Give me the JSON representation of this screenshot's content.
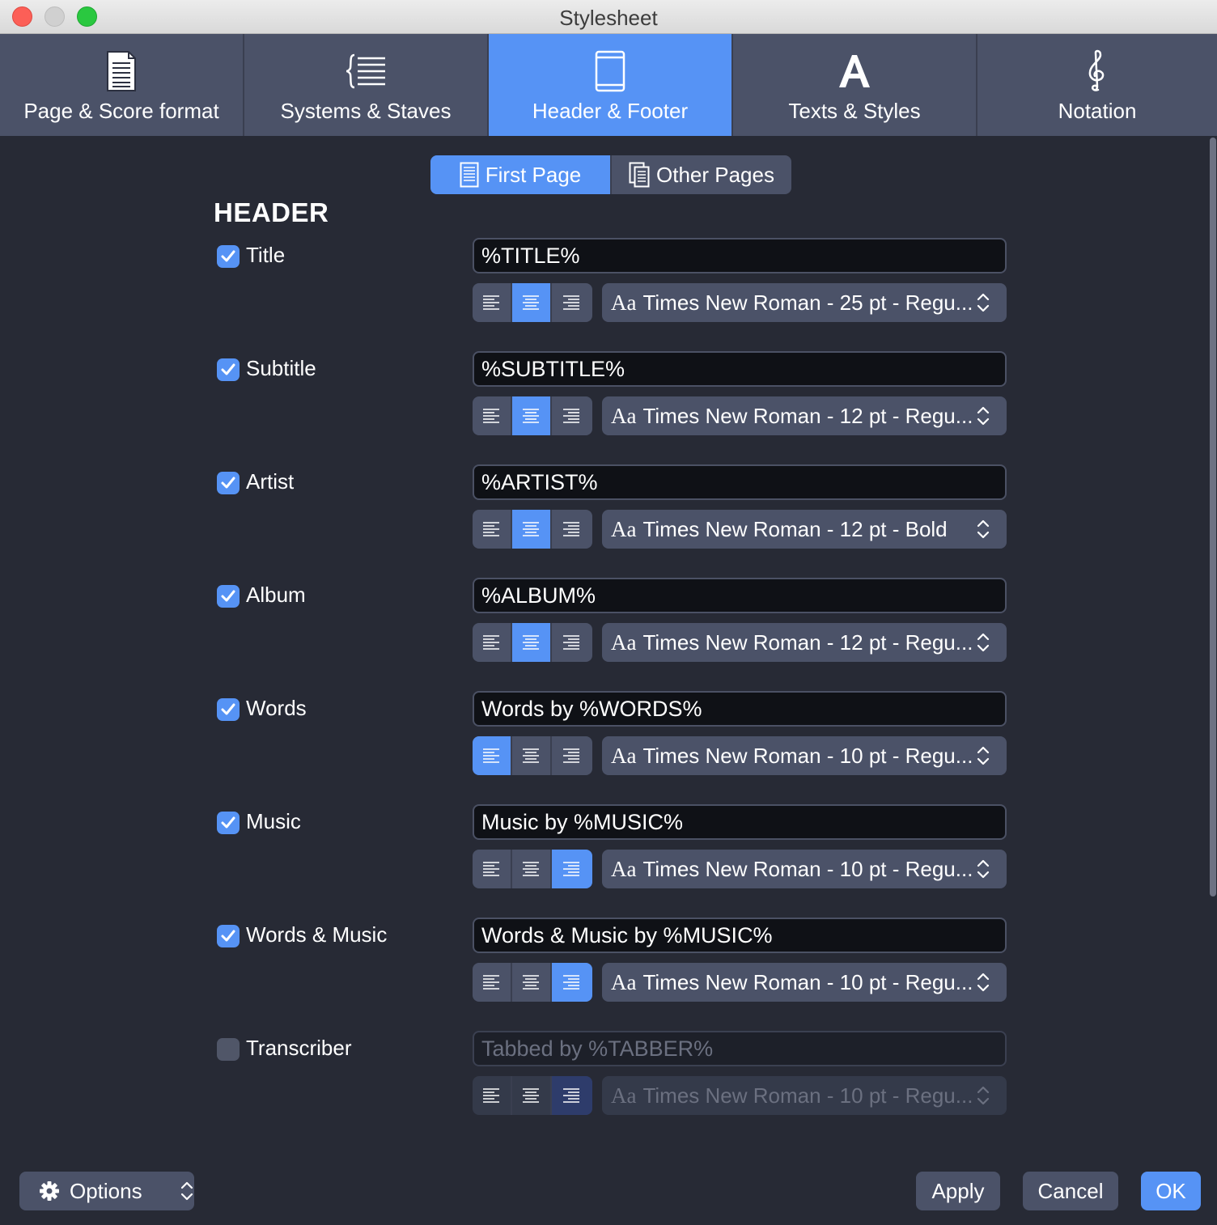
{
  "window": {
    "title": "Stylesheet"
  },
  "tabs": [
    {
      "label": "Page & Score format",
      "icon": "page-icon",
      "active": false
    },
    {
      "label": "Systems & Staves",
      "icon": "staves-icon",
      "active": false
    },
    {
      "label": "Header & Footer",
      "icon": "header-footer-icon",
      "active": true
    },
    {
      "label": "Texts & Styles",
      "icon": "letter-a-icon",
      "active": false
    },
    {
      "label": "Notation",
      "icon": "treble-clef-icon",
      "active": false
    }
  ],
  "page_selector": {
    "first_page": "First Page",
    "other_pages": "Other Pages",
    "selected": "First Page"
  },
  "section_title": "HEADER",
  "fields": [
    {
      "label": "Title",
      "checked": true,
      "value": "%TITLE%",
      "align": "center",
      "font": "Times New Roman - 25 pt - Regu..."
    },
    {
      "label": "Subtitle",
      "checked": true,
      "value": "%SUBTITLE%",
      "align": "center",
      "font": "Times New Roman - 12 pt - Regu..."
    },
    {
      "label": "Artist",
      "checked": true,
      "value": "%ARTIST%",
      "align": "center",
      "font": "Times New Roman - 12 pt - Bold"
    },
    {
      "label": "Album",
      "checked": true,
      "value": "%ALBUM%",
      "align": "center",
      "font": "Times New Roman - 12 pt - Regu..."
    },
    {
      "label": "Words",
      "checked": true,
      "value": "Words by %WORDS%",
      "align": "left",
      "font": "Times New Roman - 10 pt - Regu..."
    },
    {
      "label": "Music",
      "checked": true,
      "value": "Music by %MUSIC%",
      "align": "right",
      "font": "Times New Roman - 10 pt - Regu..."
    },
    {
      "label": "Words & Music",
      "checked": true,
      "value": "Words & Music by %MUSIC%",
      "align": "right",
      "font": "Times New Roman - 10 pt - Regu..."
    },
    {
      "label": "Transcriber",
      "checked": false,
      "value": "Tabbed by %TABBER%",
      "align": "right",
      "font": "Times New Roman - 10 pt - Regu..."
    }
  ],
  "font_prefix": "Aa",
  "bottom": {
    "options": "Options",
    "apply": "Apply",
    "cancel": "Cancel",
    "ok": "OK"
  },
  "colors": {
    "accent": "#5693f5",
    "background": "#272a35",
    "control": "#4b5268"
  }
}
